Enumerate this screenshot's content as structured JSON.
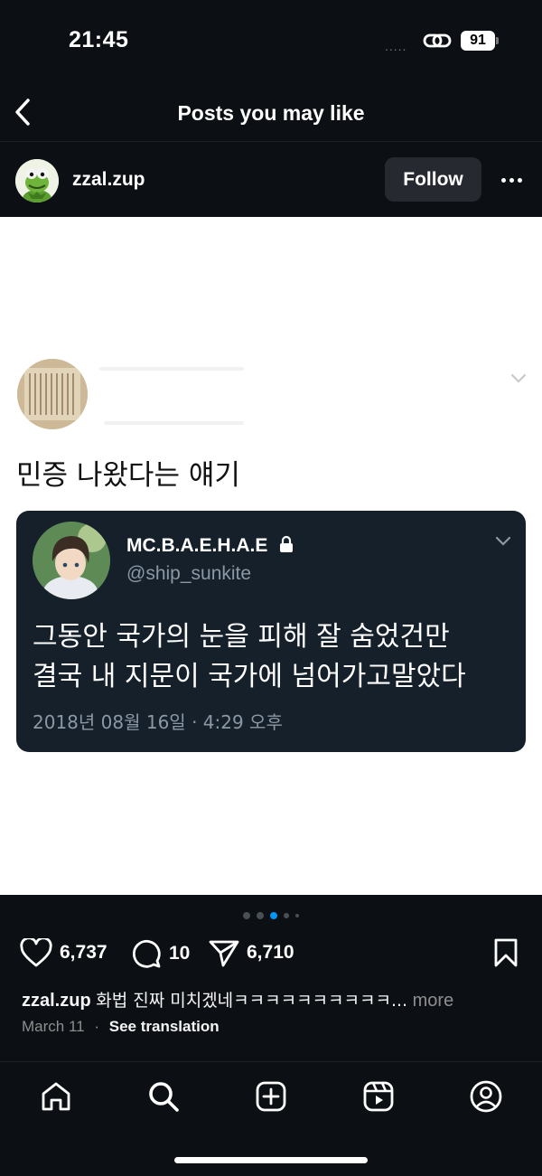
{
  "status_bar": {
    "time": "21:45",
    "battery": "91",
    "signal": "....."
  },
  "header": {
    "title": "Posts you may like"
  },
  "post": {
    "username": "zzal.zup",
    "follow_label": "Follow",
    "image": {
      "tweet_text": "민증 나왔다는 얘기",
      "quote": {
        "display_name": "MC.B.A.E.H.A.E",
        "handle": "@ship_sunkite",
        "text_line1": "그동안 국가의 눈을 피해 잘 숨었건만",
        "text_line2": "결국 내 지문이 국가에 넘어가고말았다",
        "date": "2018년 08월 16일 · 4:29 오후"
      }
    },
    "carousel": {
      "count": 5,
      "active_index": 2
    },
    "likes": "6,737",
    "comments": "10",
    "shares": "6,710",
    "caption": {
      "user": "zzal.zup",
      "text": "화법 진짜 미치겠네ㅋㅋㅋㅋㅋㅋㅋㅋㅋㅋ...",
      "more": "more"
    },
    "date": "March 11",
    "separator": "·",
    "see_translation": "See translation"
  },
  "tab_bar": {
    "items": [
      "home-icon",
      "search-icon",
      "create-icon",
      "reels-icon",
      "profile-icon"
    ]
  },
  "colors": {
    "background": "#0c1014",
    "quote_card": "#15202b",
    "accent": "#0095f6",
    "follow_button": "#262a30"
  }
}
